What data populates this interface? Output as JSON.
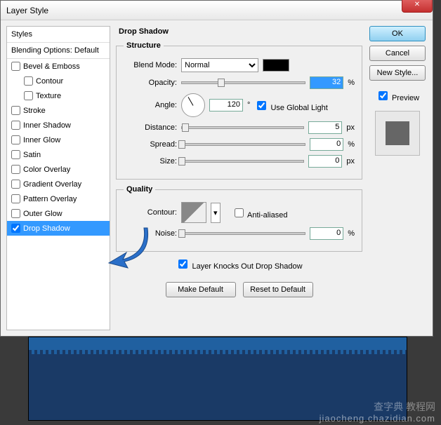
{
  "title": "Layer Style",
  "styles_header": "Styles",
  "blending": "Blending Options: Default",
  "style_items": [
    {
      "label": "Bevel & Emboss",
      "checked": false,
      "indent": false
    },
    {
      "label": "Contour",
      "checked": false,
      "indent": true
    },
    {
      "label": "Texture",
      "checked": false,
      "indent": true
    },
    {
      "label": "Stroke",
      "checked": false,
      "indent": false
    },
    {
      "label": "Inner Shadow",
      "checked": false,
      "indent": false
    },
    {
      "label": "Inner Glow",
      "checked": false,
      "indent": false
    },
    {
      "label": "Satin",
      "checked": false,
      "indent": false
    },
    {
      "label": "Color Overlay",
      "checked": false,
      "indent": false
    },
    {
      "label": "Gradient Overlay",
      "checked": false,
      "indent": false
    },
    {
      "label": "Pattern Overlay",
      "checked": false,
      "indent": false
    },
    {
      "label": "Outer Glow",
      "checked": false,
      "indent": false
    },
    {
      "label": "Drop Shadow",
      "checked": true,
      "indent": false,
      "active": true
    }
  ],
  "section_title": "Drop Shadow",
  "structure": {
    "legend": "Structure",
    "blend_mode_lbl": "Blend Mode:",
    "blend_mode_val": "Normal",
    "opacity_lbl": "Opacity:",
    "opacity_val": "32",
    "opacity_unit": "%",
    "angle_lbl": "Angle:",
    "angle_val": "120",
    "angle_unit": "°",
    "global_light": "Use Global Light",
    "distance_lbl": "Distance:",
    "distance_val": "5",
    "distance_unit": "px",
    "spread_lbl": "Spread:",
    "spread_val": "0",
    "spread_unit": "%",
    "size_lbl": "Size:",
    "size_val": "0",
    "size_unit": "px"
  },
  "quality": {
    "legend": "Quality",
    "contour_lbl": "Contour:",
    "antialiased": "Anti-aliased",
    "noise_lbl": "Noise:",
    "noise_val": "0",
    "noise_unit": "%"
  },
  "knockout": "Layer Knocks Out Drop Shadow",
  "make_default": "Make Default",
  "reset_default": "Reset to Default",
  "ok": "OK",
  "cancel": "Cancel",
  "new_style": "New Style...",
  "preview": "Preview",
  "watermark": "jiaocheng.chazidian.com",
  "watermark2": "查字典 教程网"
}
